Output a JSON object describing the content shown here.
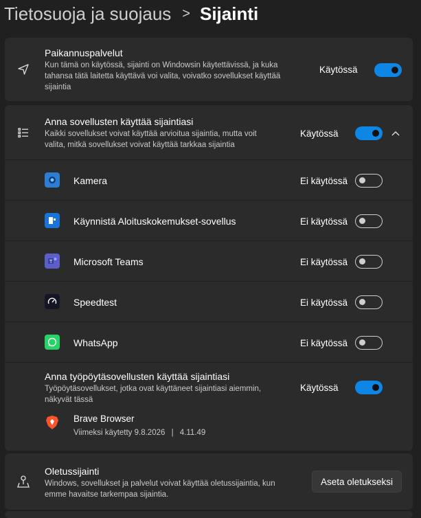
{
  "breadcrumb": {
    "parent": "Tietosuoja ja suojaus",
    "separator": ">",
    "current": "Sijainti"
  },
  "location_services": {
    "title": "Paikannuspalvelut",
    "description": "Kun tämä on käytössä, sijainti on Windowsin käytettävissä, ja kuka tahansa tätä laitetta käyttävä voi valita, voivatko sovellukset käyttää sijaintia",
    "state_label": "Käytössä",
    "enabled": true,
    "icon": "location-arrow-icon"
  },
  "app_access": {
    "title": "Anna sovellusten käyttää sijaintiasi",
    "description": "Kaikki sovellukset voivat käyttää arvioitua sijaintia, mutta voit valita, mitkä sovellukset voivat käyttää tarkkaa sijaintia",
    "state_label": "Käytössä",
    "enabled": true,
    "expanded": true,
    "icon": "list-icon",
    "apps": [
      {
        "name": "Kamera",
        "state_label": "Ei käytössä",
        "enabled": false,
        "icon": "camera-icon",
        "color": "#2d7dd2"
      },
      {
        "name": "Käynnistä Aloituskokemukset-sovellus",
        "state_label": "Ei käytössä",
        "enabled": false,
        "icon": "get-started-icon",
        "color": "#1a73d9"
      },
      {
        "name": "Microsoft Teams",
        "state_label": "Ei käytössä",
        "enabled": false,
        "icon": "teams-icon",
        "color": "#5b5fc7"
      },
      {
        "name": "Speedtest",
        "state_label": "Ei käytössä",
        "enabled": false,
        "icon": "speedtest-icon",
        "color": "#141526"
      },
      {
        "name": "WhatsApp",
        "state_label": "Ei käytössä",
        "enabled": false,
        "icon": "whatsapp-icon",
        "color": "#25d366"
      }
    ]
  },
  "desktop_apps": {
    "title": "Anna työpöytäsovellusten käyttää sijaintiasi",
    "description": "Työpöytäsovellukset, jotka ovat käyttäneet sijaintiasi aiemmin, näkyvät tässä",
    "state_label": "Käytössä",
    "enabled": true,
    "apps": [
      {
        "name": "Brave Browser",
        "last_used": "Viimeksi käytetty 9.8.2026",
        "separator": "|",
        "time": "4.11.49",
        "icon": "brave-icon",
        "color": "#fb542b"
      }
    ]
  },
  "default_location": {
    "title": "Oletussijainti",
    "description": "Windows, sovellukset ja palvelut voivat käyttää oletussijaintia, kun emme havaitse tarkempaa sijaintia.",
    "button_label": "Aseta oletukseksi",
    "icon": "map-pin-icon"
  },
  "colors": {
    "background": "#202020",
    "card": "#2b2b2b",
    "accent": "#0e86e6"
  }
}
